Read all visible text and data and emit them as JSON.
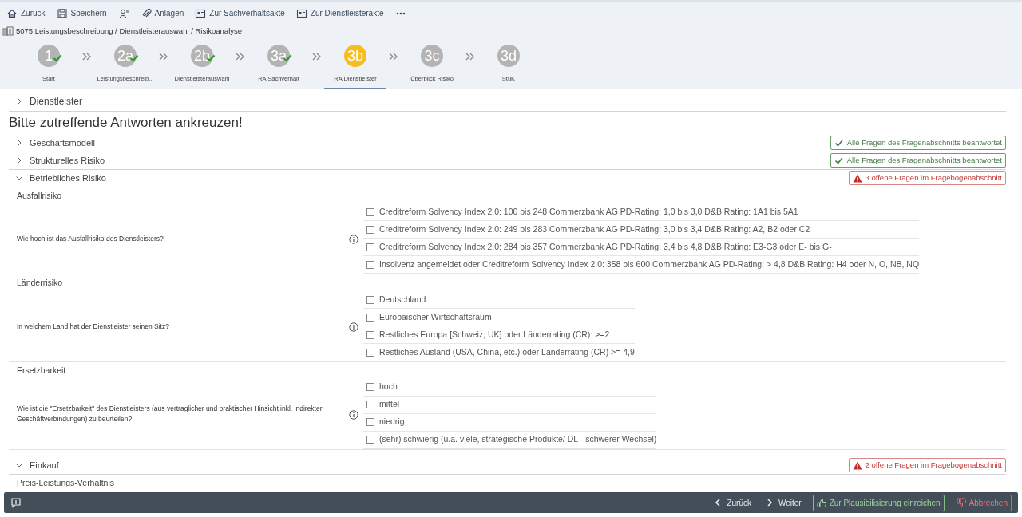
{
  "toolbar": [
    "Zurück",
    "Speichern",
    "Anlagen",
    "Zur Sachverhaltsakte",
    "Zur Dienstleisterakte"
  ],
  "breadcrumb": "5075 Leistungsbeschreibung / Dienstleisterauswahl / Risikoanalyse",
  "steps": [
    {
      "number": "1",
      "label": "Start",
      "done": true,
      "selected": false
    },
    {
      "number": "2a",
      "label": "Leistungsbeschreib...",
      "done": true,
      "selected": false
    },
    {
      "number": "2b",
      "label": "Dienstleisterauswahl",
      "done": true,
      "selected": false
    },
    {
      "number": "3a",
      "label": "RA Sachverhalt",
      "done": true,
      "selected": false
    },
    {
      "number": "3b",
      "label": "RA Dienstleister",
      "done": false,
      "selected": true
    },
    {
      "number": "3c",
      "label": "Überblick Risiko",
      "done": false,
      "selected": false
    },
    {
      "number": "3d",
      "label": "StüK",
      "done": false,
      "selected": false
    }
  ],
  "top_section": {
    "title": "Dienstleister",
    "expanded": false
  },
  "instruction": "Bitte zutreffende Antworten ankreuzen!",
  "sections": [
    {
      "title": "Geschäftsmodell",
      "expanded": false,
      "status": {
        "kind": "ok",
        "text": "Alle Fragen des Fragenabschnitts beantwortet"
      }
    },
    {
      "title": "Strukturelles Risiko",
      "expanded": false,
      "status": {
        "kind": "ok",
        "text": "Alle Fragen des Fragenabschnitts beantwortet"
      }
    },
    {
      "title": "Betriebliches Risiko",
      "expanded": true,
      "status": {
        "kind": "warn",
        "text": "3 offene Fragen im Fragebogenabschnitt"
      },
      "groups": [
        {
          "title": "Ausfallrisiko",
          "question": "Wie hoch ist das Ausfallrisiko des Dienstleisters?",
          "options": [
            {
              "label": "Creditreform Solvency Index 2.0: 100 bis 248 Commerzbank AG PD-Rating: 1,0 bis 3,0 D&B Rating: 1A1 bis 5A1",
              "checked": false
            },
            {
              "label": "Creditreform Solvency Index 2.0: 249 bis 283 Commerzbank AG PD-Rating: 3,0 bis 3,4 D&B Rating: A2, B2 oder C2",
              "checked": false
            },
            {
              "label": "Creditreform Solvency Index 2.0: 284 bis 357 Commerzbank AG PD-Rating: 3,4 bis 4,8 D&B Rating: E3-G3 oder E- bis G-",
              "checked": false
            },
            {
              "label": "Insolvenz angemeldet oder Creditreform Solvency Index 2.0: 358 bis 600 Commerzbank AG PD-Rating: > 4,8 D&B Rating: H4 oder N, O, NB, NQ",
              "checked": false
            }
          ]
        },
        {
          "title": "Länderrisiko",
          "question": "In welchem Land hat der Dienstleister seinen Sitz?",
          "options": [
            {
              "label": "Deutschland",
              "checked": false
            },
            {
              "label": "Europäischer Wirtschaftsraum",
              "checked": false
            },
            {
              "label": "Restliches Europa [Schweiz, UK] oder Länderrating (CR): >=2",
              "checked": false
            },
            {
              "label": "Restliches Ausland (USA, China, etc.) oder Länderrating (CR) >= 4,9",
              "checked": false
            }
          ]
        },
        {
          "title": "Ersetzbarkeit",
          "question": "Wie ist die \"Ersetzbarkeit\" des Dienstleisters (aus vertraglicher und praktischer Hinsicht inkl. indirekter Geschäftverbindungen) zu beurteilen?",
          "options": [
            {
              "label": "hoch",
              "checked": false
            },
            {
              "label": "mittel",
              "checked": false
            },
            {
              "label": "niedrig",
              "checked": false
            },
            {
              "label": "(sehr) schwierig (u.a. viele, strategische Produkte/ DL - schwerer Wechsel)",
              "checked": false
            }
          ]
        }
      ]
    },
    {
      "title": "Einkauf",
      "expanded": true,
      "status": {
        "kind": "warn",
        "text": "2 offene Fragen im Fragebogenabschnitt"
      },
      "groups": [
        {
          "title": "Preis-Leistungs-Verhältnis"
        }
      ]
    }
  ],
  "footer": [
    {
      "label": "Zurück",
      "kind": "back"
    },
    {
      "label": "Weiter",
      "kind": "next"
    },
    {
      "label": "Zur Plausibilisierung einreichen",
      "kind": "submit"
    },
    {
      "label": "Abbrechen",
      "kind": "cancel"
    }
  ]
}
